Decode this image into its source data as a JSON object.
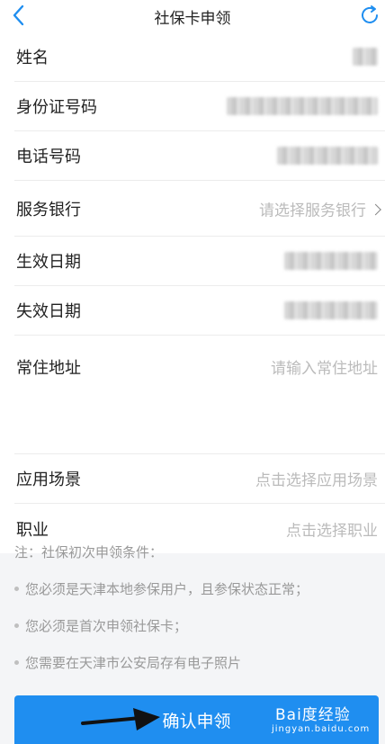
{
  "nav": {
    "title": "社保卡申领"
  },
  "form": {
    "name_label": "姓名",
    "id_label": "身份证号码",
    "phone_label": "电话号码",
    "bank_label": "服务银行",
    "bank_placeholder": "请选择服务银行",
    "start_label": "生效日期",
    "end_label": "失效日期",
    "address_label": "常住地址",
    "address_placeholder": "请输入常住地址",
    "scene_label": "应用场景",
    "scene_placeholder": "点击选择应用场景",
    "job_label": "职业",
    "job_placeholder": "点击选择职业"
  },
  "notes": {
    "title": "注：社保初次申领条件：",
    "items": [
      "您必须是天津本地参保用户，且参保状态正常；",
      "您必须是首次申领社保卡；",
      "您需要在天津市公安局存有电子照片"
    ]
  },
  "submit_label": "确认申领",
  "watermark": {
    "logo_text": "Bai度经验",
    "url_text": "jingyan.baidu.com"
  },
  "colors": {
    "primary": "#1f8ef0",
    "placeholder": "#bbbbbb",
    "background": "#f4f5f7"
  }
}
